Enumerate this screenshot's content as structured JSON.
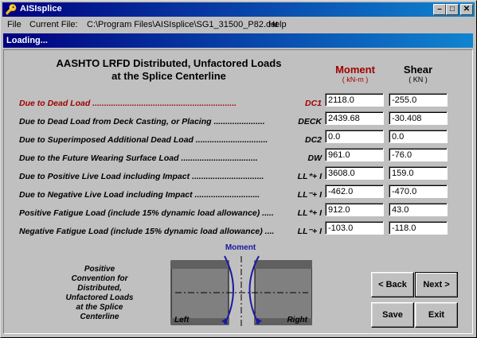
{
  "window": {
    "title": "AISIsplice",
    "icon": "key-icon"
  },
  "menu": {
    "file": "File",
    "current_file_label": "Current File:",
    "current_file_path": "C:\\Program Files\\AISIsplice\\SG1_31500_P82.dat",
    "help": "Help"
  },
  "loading": "Loading...",
  "heading": {
    "line1": "AASHTO LRFD Distributed, Unfactored Loads",
    "line2": "at the Splice Centerline"
  },
  "columns": {
    "moment": {
      "title": "Moment",
      "unit": "( kN-m )"
    },
    "shear": {
      "title": "Shear",
      "unit": "( KN )"
    }
  },
  "rows": [
    {
      "label": "Due to Dead Load ..............................................................",
      "code": "DC1",
      "moment": "2118.0",
      "shear": "-255.0"
    },
    {
      "label": "Due to Dead Load from Deck Casting, or Placing ......................",
      "code": "DECK",
      "moment": "2439.68",
      "shear": "-30.408"
    },
    {
      "label": "Due to Superimposed Additional Dead Load ...............................",
      "code": "DC2",
      "moment": "0.0",
      "shear": "0.0"
    },
    {
      "label": "Due to the Future Wearing Surface Load .................................",
      "code": "DW",
      "moment": "961.0",
      "shear": "-76.0"
    },
    {
      "label": "Due to Positive Live Load including Impact ...............................",
      "code": "LL⁺+ I",
      "moment": "3608.0",
      "shear": "159.0"
    },
    {
      "label": "Due to Negative Live Load including Impact ............................",
      "code": "LL⁻+ I",
      "moment": "-462.0",
      "shear": "-470.0"
    },
    {
      "label": "Positive Fatigue Load (include 15% dynamic load allowance) .....",
      "code": "LL⁺+ I",
      "moment": "912.0",
      "shear": "43.0"
    },
    {
      "label": "Negative Fatigue Load (include 15% dynamic load allowance) ....",
      "code": "LL⁻+ I",
      "moment": "-103.0",
      "shear": "-118.0"
    }
  ],
  "convention": {
    "text_lines": [
      "Positive",
      "Convention for",
      "Distributed,",
      "Unfactored Loads",
      "at the Splice",
      "Centerline"
    ],
    "diagram_title": "Moment",
    "left": "Left",
    "right": "Right"
  },
  "buttons": {
    "back": "< Back",
    "next": "Next >",
    "save": "Save",
    "exit": "Exit"
  },
  "colors": {
    "accent_red": "#a00000",
    "title_blue": "#000080",
    "moment_blue": "#1a1aa0"
  }
}
